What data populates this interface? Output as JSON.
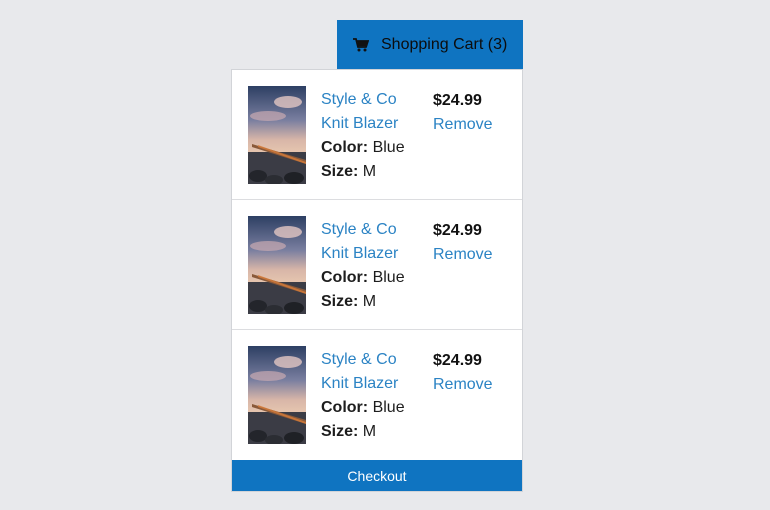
{
  "cart_button": {
    "icon": "shopping-cart-icon",
    "label": "Shopping Cart (3)"
  },
  "items": [
    {
      "name_line1": "Style & Co",
      "name_line2": "Knit Blazer",
      "color_label": "Color:",
      "color_value": "Blue",
      "size_label": "Size:",
      "size_value": "M",
      "price": "$24.99",
      "remove_label": "Remove"
    },
    {
      "name_line1": "Style & Co",
      "name_line2": "Knit Blazer",
      "color_label": "Color:",
      "color_value": "Blue",
      "size_label": "Size:",
      "size_value": "M",
      "price": "$24.99",
      "remove_label": "Remove"
    },
    {
      "name_line1": "Style & Co",
      "name_line2": "Knit Blazer",
      "color_label": "Color:",
      "color_value": "Blue",
      "size_label": "Size:",
      "size_value": "M",
      "price": "$24.99",
      "remove_label": "Remove"
    }
  ],
  "checkout": {
    "label": "Checkout"
  },
  "colors": {
    "accent": "#0f74c1",
    "link": "#2b83c4",
    "background": "#e8e9ec"
  }
}
